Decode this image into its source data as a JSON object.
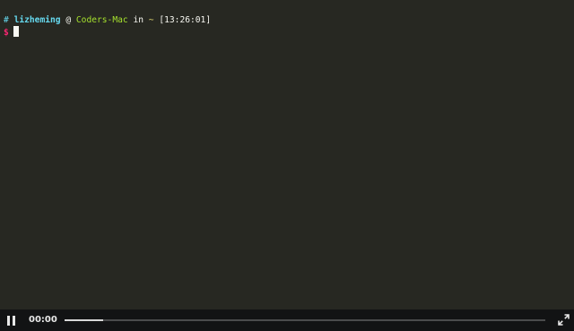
{
  "terminal": {
    "prompt_line": {
      "hash": "#",
      "user": "lizheming",
      "at": "@",
      "host": "Coders-Mac",
      "in": "in",
      "cwd": "~",
      "time": "[13:26:01]"
    },
    "input_line": {
      "symbol": "$"
    }
  },
  "controls": {
    "play_state_icon": "pause-icon",
    "time": "00:00",
    "progress": 0.08,
    "fullscreen_icon": "fullscreen-icon"
  },
  "colors": {
    "terminal_bg": "#272822",
    "control_bg": "#121314",
    "user": "#66d9ef",
    "host": "#a6e22e",
    "cwd": "#e6db74",
    "dollar": "#f92672",
    "text": "#f8f8f2"
  }
}
